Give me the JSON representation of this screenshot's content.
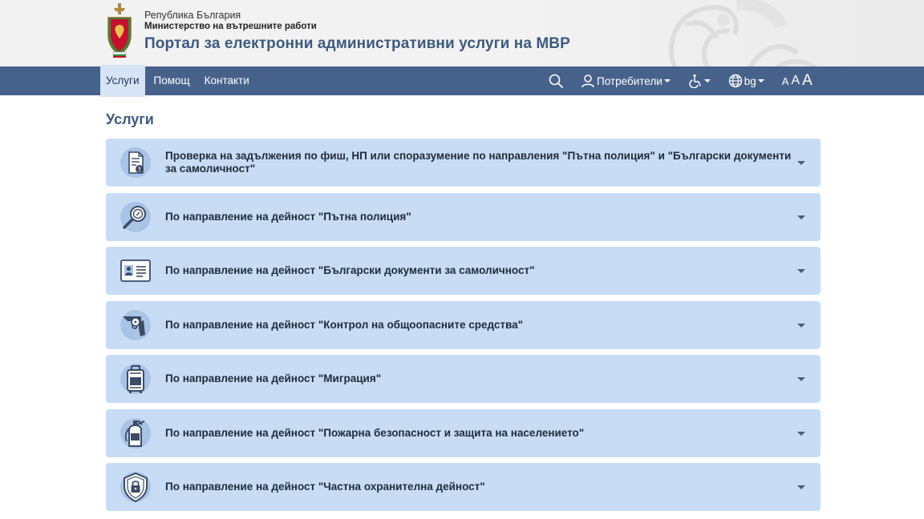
{
  "header": {
    "republic": "Република България",
    "ministry": "Министерство на вътрешните работи",
    "portal_title": "Портал за електронни административни услуги на МВР"
  },
  "nav": {
    "items": [
      {
        "label": "Услуги",
        "active": true
      },
      {
        "label": "Помощ",
        "active": false
      },
      {
        "label": "Контакти",
        "active": false
      }
    ],
    "search_icon": "search-icon",
    "users_label": "Потребители",
    "accessibility_icon": "wheelchair-icon",
    "language_label": "bg",
    "font_small": "A",
    "font_normal": "A",
    "font_large": "A"
  },
  "page": {
    "title": "Услуги"
  },
  "services": [
    {
      "icon": "document-fine-icon",
      "label": "Проверка на задължения по фиш, НП или споразумение по направления \"Пътна полиция\" и \"Български документи за самоличност\""
    },
    {
      "icon": "magnifier-badge-icon",
      "label": "По направление на дейност \"Пътна полиция\""
    },
    {
      "icon": "id-card-icon",
      "label": "По направление на дейност \"Български документи за самоличност\""
    },
    {
      "icon": "revolver-icon",
      "label": "По направление на дейност \"Контрол на общоопасните средства\""
    },
    {
      "icon": "suitcase-icon",
      "label": "По направление на дейност \"Миграция\""
    },
    {
      "icon": "fire-extinguisher-icon",
      "label": "По направление на дейност \"Пожарна безопасност и защита на населението\""
    },
    {
      "icon": "shield-lock-icon",
      "label": "По направление на дейност \"Частна охранителна дейност\""
    }
  ],
  "colors": {
    "navbar": "#47628a",
    "title_blue": "#3d5a80",
    "card_bg": "#c9dcf5",
    "active_tab": "#d6e4f5"
  }
}
